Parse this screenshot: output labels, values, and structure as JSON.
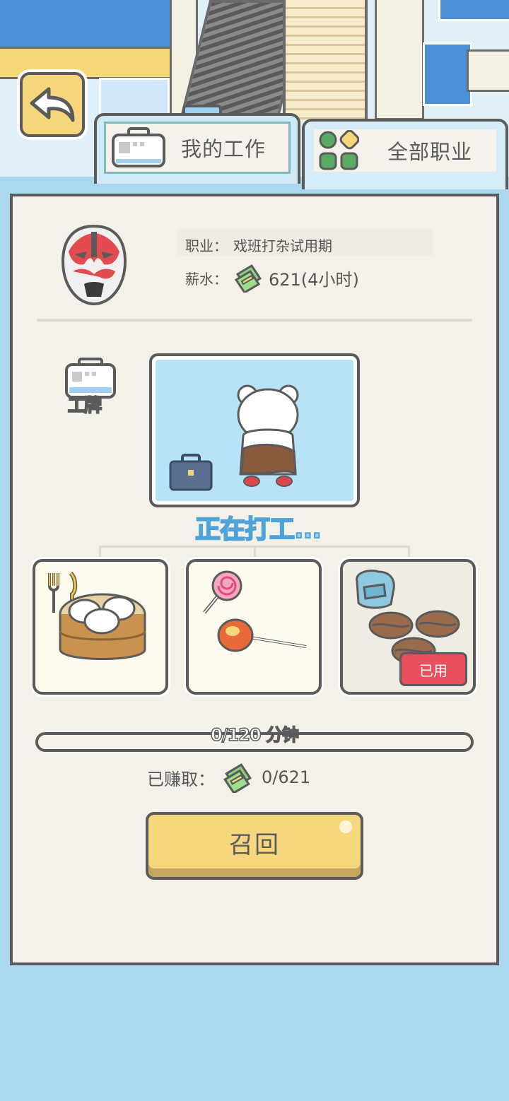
{
  "tabs": {
    "my_job": "我的工作",
    "all_jobs": "全部职业"
  },
  "job": {
    "label_job": "职业：",
    "title": "戏班打杂试用期",
    "label_salary": "薪水：",
    "salary": "621(4小时)"
  },
  "badge_label": "工牌",
  "status_text": "正在打工...",
  "slots": {
    "used_label": "已用"
  },
  "progress": {
    "text": "0/120 分钟",
    "fraction": 0
  },
  "earned": {
    "label": "已赚取：",
    "value": "0/621"
  },
  "recall_label": "召回",
  "colors": {
    "background": "#a9d8ef",
    "panel": "#f4f1e9",
    "button": "#f7d77d",
    "used_badge": "#e9505c",
    "status_text": "#9fd0ef"
  }
}
